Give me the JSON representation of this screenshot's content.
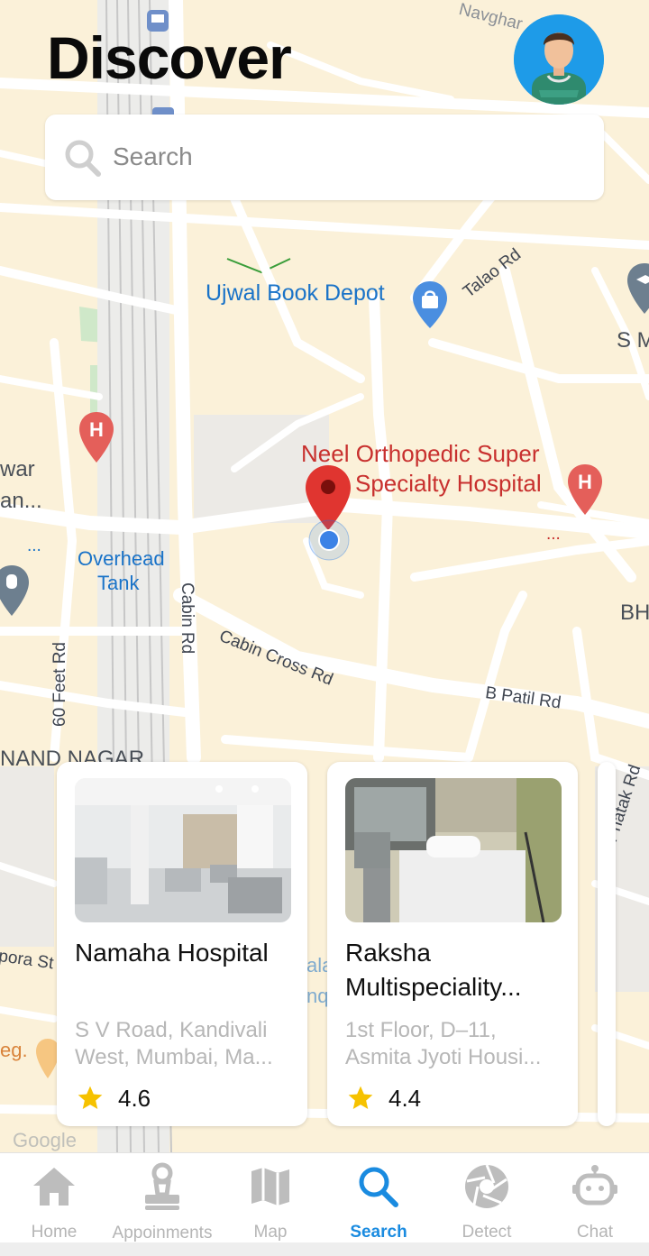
{
  "header": {
    "title": "Discover"
  },
  "search": {
    "placeholder": "Search"
  },
  "map": {
    "places": {
      "book_depot": "Ujwal Book Depot",
      "hospital_line1": "Neel Orthopedic Super",
      "hospital_line2": "Specialty Hospital",
      "overhead_1": "Overhead",
      "overhead_2": "Tank",
      "nand_nagar": "NAND NAGAR",
      "war": "war",
      "an": "an...",
      "sm": "S M",
      "bh": "BH",
      "ala": "ala",
      "nq": "nq",
      "pora": "pora St",
      "eg": "eg.",
      "google": "Google",
      "dots1": "...",
      "dots2": "..."
    },
    "roads": {
      "talao": "Talao Rd",
      "cabin": "Cabin Rd",
      "cabin_cross": "Cabin Cross Rd",
      "patil": "B Patil Rd",
      "feet60": "60 Feet Rd",
      "phatak": "Phatak Rd",
      "navghar": "Navghar"
    }
  },
  "cards": [
    {
      "name": "Namaha Hospital",
      "address": "S V Road, Kandivali West, Mumbai, Ma...",
      "rating": "4.6"
    },
    {
      "name": "Raksha Multispeciality...",
      "address_line1": "1st Floor, D–11,",
      "address_line2": "Asmita Jyoti Housi...",
      "rating": "4.4"
    }
  ],
  "nav": {
    "items": [
      {
        "label": "Home",
        "icon": "home-icon"
      },
      {
        "label": "Appoinments",
        "icon": "appointments-icon"
      },
      {
        "label": "Map",
        "icon": "map-icon"
      },
      {
        "label": "Search",
        "icon": "search-icon"
      },
      {
        "label": "Detect",
        "icon": "aperture-icon"
      },
      {
        "label": "Chat",
        "icon": "robot-icon"
      }
    ],
    "active": "Search"
  },
  "colors": {
    "accent": "#1a8be0",
    "pin_red": "#e53935",
    "map_bg": "#fbf1d9",
    "star": "#f6c200"
  }
}
